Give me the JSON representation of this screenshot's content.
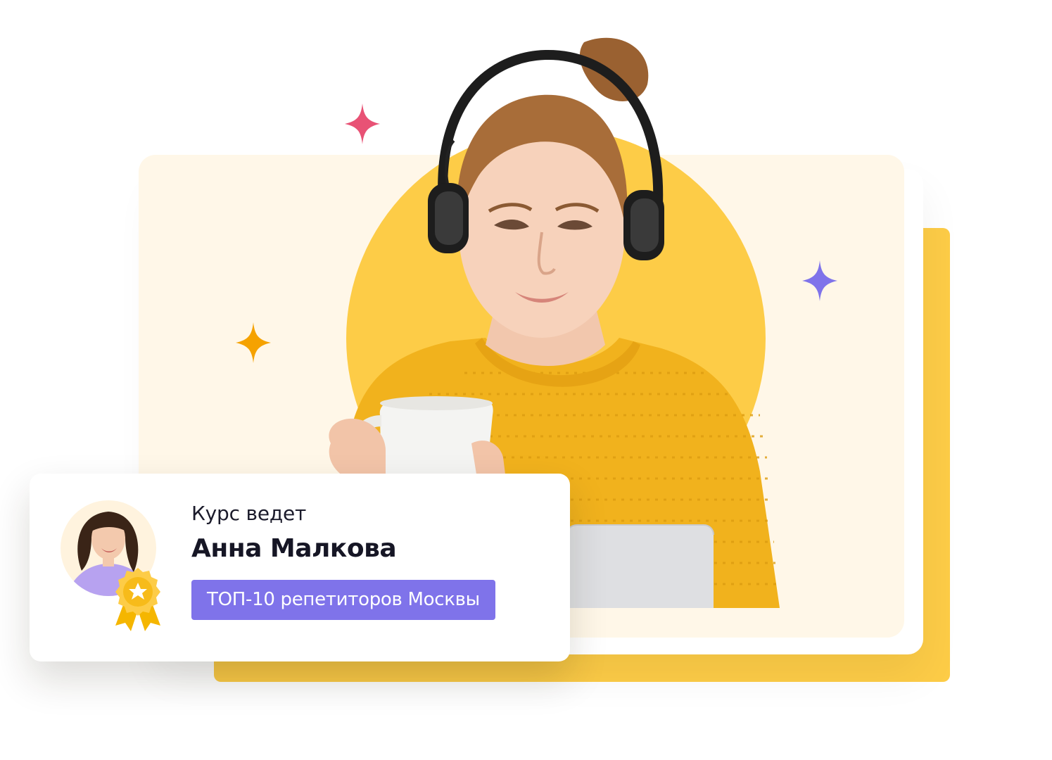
{
  "colors": {
    "accent": "#fdcc47",
    "panel": "#fff7e8",
    "badge": "#7f73ea",
    "sparkle_pink": "#e85275",
    "sparkle_orange": "#f5a200",
    "sparkle_purple": "#7f73ea"
  },
  "icons": {
    "sparkles": [
      "sparkle-icon",
      "sparkle-icon",
      "sparkle-icon"
    ],
    "award": "award-ribbon-icon"
  },
  "teacher_card": {
    "subtitle": "Курс ведет",
    "name": "Анна Малкова",
    "badge": "ТОП-10 репетиторов Москвы"
  }
}
